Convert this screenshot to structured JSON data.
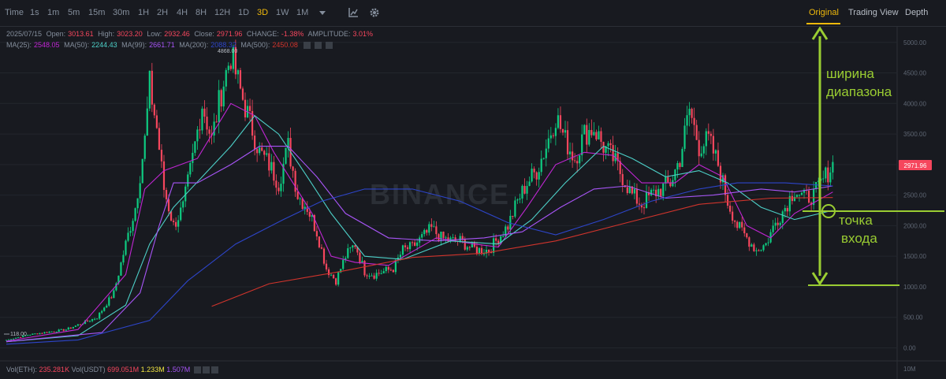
{
  "toolbar": {
    "time_label": "Time",
    "intervals": [
      "1s",
      "1m",
      "5m",
      "15m",
      "30m",
      "1H",
      "2H",
      "4H",
      "8H",
      "12H",
      "1D",
      "3D",
      "1W",
      "1M"
    ],
    "active_interval": "3D",
    "views": [
      "Original",
      "Trading View",
      "Depth"
    ],
    "active_view": "Original"
  },
  "ohlc": {
    "date": "2025/07/15",
    "open_label": "Open:",
    "open": "3013.61",
    "high_label": "High:",
    "high": "3023.20",
    "low_label": "Low:",
    "low": "2932.46",
    "close_label": "Close:",
    "close": "2971.96",
    "change_label": "CHANGE:",
    "change": "-1.38%",
    "amplitude_label": "AMPLITUDE:",
    "amplitude": "3.01%"
  },
  "ma": [
    {
      "label": "MA(25):",
      "value": "2548.05",
      "color": "#c026d3"
    },
    {
      "label": "MA(50):",
      "value": "2244.43",
      "color": "#4dd0c8"
    },
    {
      "label": "MA(99):",
      "value": "2661.71",
      "color": "#a855f7"
    },
    {
      "label": "MA(200):",
      "value": "2088.32",
      "color": "#2d45c9"
    },
    {
      "label": "MA(500):",
      "value": "2450.08",
      "color": "#d0342c"
    }
  ],
  "volume": {
    "eth_label": "Vol(ETH):",
    "eth": "235.281K",
    "usdt_label": "Vol(USDT)",
    "usdt": "699.051M",
    "v1": "1.233M",
    "v2": "1.507M",
    "v1_color": "#f0e442",
    "v2_color": "#a855f7",
    "axis_label": "10M"
  },
  "price_tag": {
    "value": "2971.96",
    "color": "#f6465d"
  },
  "annotations": {
    "range_label_line1": "ширина",
    "range_label_line2": "диапазона",
    "entry_label_line1": "точка",
    "entry_label_line2": "входа",
    "color": "#9acd32"
  },
  "watermark": "BINANCE",
  "chart_data": {
    "type": "candlestick",
    "title": "",
    "interval": "3D",
    "y_ticks": [
      0,
      500,
      1000,
      1500,
      2000,
      2500,
      3000,
      3500,
      4000,
      4500,
      5000
    ],
    "y_tick_labels": [
      "0.00",
      "500.00",
      "1000.00",
      "1500.00",
      "2000.00",
      "2500.00",
      "3000.00",
      "3500.00",
      "4000.00",
      "4500.00",
      "5000.00"
    ],
    "ylim": [
      -50,
      5300
    ],
    "high_marker": "4868.00",
    "low_marker": "118.00",
    "anchors": [
      [
        0,
        130
      ],
      [
        10,
        220
      ],
      [
        25,
        300
      ],
      [
        38,
        500
      ],
      [
        45,
        900
      ],
      [
        50,
        1700
      ],
      [
        54,
        2300
      ],
      [
        58,
        3400
      ],
      [
        60,
        4300
      ],
      [
        63,
        3600
      ],
      [
        66,
        2600
      ],
      [
        70,
        2000
      ],
      [
        74,
        2300
      ],
      [
        78,
        3100
      ],
      [
        82,
        4000
      ],
      [
        86,
        3400
      ],
      [
        90,
        4200
      ],
      [
        94,
        4800
      ],
      [
        98,
        4200
      ],
      [
        102,
        3700
      ],
      [
        106,
        3200
      ],
      [
        110,
        3000
      ],
      [
        114,
        2700
      ],
      [
        118,
        3300
      ],
      [
        122,
        2500
      ],
      [
        126,
        2300
      ],
      [
        130,
        1900
      ],
      [
        134,
        1300
      ],
      [
        138,
        1100
      ],
      [
        142,
        1500
      ],
      [
        146,
        1700
      ],
      [
        150,
        1250
      ],
      [
        154,
        1200
      ],
      [
        158,
        1250
      ],
      [
        162,
        1300
      ],
      [
        166,
        1600
      ],
      [
        170,
        1650
      ],
      [
        174,
        1800
      ],
      [
        178,
        1950
      ],
      [
        182,
        1800
      ],
      [
        186,
        1750
      ],
      [
        190,
        1750
      ],
      [
        194,
        1650
      ],
      [
        198,
        1600
      ],
      [
        202,
        1600
      ],
      [
        206,
        1800
      ],
      [
        210,
        2000
      ],
      [
        214,
        2400
      ],
      [
        218,
        2700
      ],
      [
        222,
        2900
      ],
      [
        226,
        3300
      ],
      [
        230,
        3800
      ],
      [
        234,
        3400
      ],
      [
        238,
        3100
      ],
      [
        242,
        3500
      ],
      [
        246,
        3600
      ],
      [
        250,
        3300
      ],
      [
        254,
        3100
      ],
      [
        258,
        2800
      ],
      [
        262,
        2500
      ],
      [
        266,
        2350
      ],
      [
        270,
        2500
      ],
      [
        274,
        2600
      ],
      [
        278,
        2700
      ],
      [
        282,
        3100
      ],
      [
        286,
        3900
      ],
      [
        290,
        3300
      ],
      [
        294,
        3400
      ],
      [
        298,
        3000
      ],
      [
        302,
        2400
      ],
      [
        306,
        2000
      ],
      [
        310,
        1800
      ],
      [
        314,
        1600
      ],
      [
        318,
        1700
      ],
      [
        322,
        2050
      ],
      [
        326,
        2300
      ],
      [
        330,
        2600
      ],
      [
        334,
        2450
      ],
      [
        338,
        2500
      ],
      [
        342,
        2750
      ],
      [
        346,
        3000
      ]
    ],
    "ma_series": [
      {
        "name": "MA(25)",
        "color": "#c026d3",
        "points": [
          [
            0,
            110
          ],
          [
            30,
            300
          ],
          [
            50,
            1200
          ],
          [
            58,
            2600
          ],
          [
            66,
            2900
          ],
          [
            80,
            3100
          ],
          [
            94,
            4000
          ],
          [
            104,
            3800
          ],
          [
            112,
            3200
          ],
          [
            120,
            2700
          ],
          [
            128,
            2200
          ],
          [
            136,
            1500
          ],
          [
            146,
            1400
          ],
          [
            160,
            1350
          ],
          [
            180,
            1800
          ],
          [
            196,
            1700
          ],
          [
            206,
            1650
          ],
          [
            218,
            2300
          ],
          [
            230,
            3000
          ],
          [
            242,
            3200
          ],
          [
            254,
            3150
          ],
          [
            266,
            2700
          ],
          [
            280,
            2700
          ],
          [
            290,
            3000
          ],
          [
            300,
            2800
          ],
          [
            310,
            2000
          ],
          [
            320,
            1800
          ],
          [
            330,
            2200
          ],
          [
            346,
            2550
          ]
        ]
      },
      {
        "name": "MA(50)",
        "color": "#4dd0c8",
        "points": [
          [
            0,
            100
          ],
          [
            30,
            200
          ],
          [
            50,
            700
          ],
          [
            60,
            1700
          ],
          [
            70,
            2300
          ],
          [
            82,
            2800
          ],
          [
            94,
            3300
          ],
          [
            104,
            3800
          ],
          [
            114,
            3500
          ],
          [
            126,
            2800
          ],
          [
            136,
            2200
          ],
          [
            150,
            1500
          ],
          [
            166,
            1450
          ],
          [
            186,
            1750
          ],
          [
            206,
            1700
          ],
          [
            220,
            2100
          ],
          [
            234,
            2700
          ],
          [
            250,
            3300
          ],
          [
            262,
            3100
          ],
          [
            276,
            2800
          ],
          [
            290,
            2900
          ],
          [
            302,
            2700
          ],
          [
            316,
            2300
          ],
          [
            330,
            2100
          ],
          [
            346,
            2250
          ]
        ]
      },
      {
        "name": "MA(99)",
        "color": "#a855f7",
        "points": [
          [
            0,
            100
          ],
          [
            40,
            250
          ],
          [
            56,
            900
          ],
          [
            64,
            2000
          ],
          [
            70,
            2700
          ],
          [
            80,
            2700
          ],
          [
            94,
            3000
          ],
          [
            106,
            3300
          ],
          [
            118,
            3300
          ],
          [
            130,
            2800
          ],
          [
            142,
            2200
          ],
          [
            160,
            1800
          ],
          [
            180,
            1750
          ],
          [
            200,
            1800
          ],
          [
            216,
            1900
          ],
          [
            232,
            2300
          ],
          [
            246,
            2600
          ],
          [
            260,
            2650
          ],
          [
            276,
            2450
          ],
          [
            296,
            2500
          ],
          [
            316,
            2600
          ],
          [
            330,
            2550
          ],
          [
            346,
            2650
          ]
        ]
      },
      {
        "name": "MA(200)",
        "color": "#2d45c9",
        "points": [
          [
            0,
            60
          ],
          [
            30,
            130
          ],
          [
            60,
            450
          ],
          [
            76,
            1100
          ],
          [
            96,
            1700
          ],
          [
            116,
            2100
          ],
          [
            132,
            2400
          ],
          [
            150,
            2600
          ],
          [
            170,
            2600
          ],
          [
            190,
            2400
          ],
          [
            210,
            2050
          ],
          [
            230,
            1850
          ],
          [
            250,
            2100
          ],
          [
            270,
            2400
          ],
          [
            290,
            2600
          ],
          [
            306,
            2700
          ],
          [
            326,
            2700
          ],
          [
            346,
            2650
          ]
        ]
      },
      {
        "name": "MA(500)",
        "color": "#d0342c",
        "points": [
          [
            86,
            680
          ],
          [
            110,
            1050
          ],
          [
            140,
            1250
          ],
          [
            170,
            1480
          ],
          [
            200,
            1550
          ],
          [
            230,
            1750
          ],
          [
            260,
            2050
          ],
          [
            290,
            2350
          ],
          [
            320,
            2450
          ],
          [
            346,
            2460
          ]
        ]
      }
    ]
  }
}
